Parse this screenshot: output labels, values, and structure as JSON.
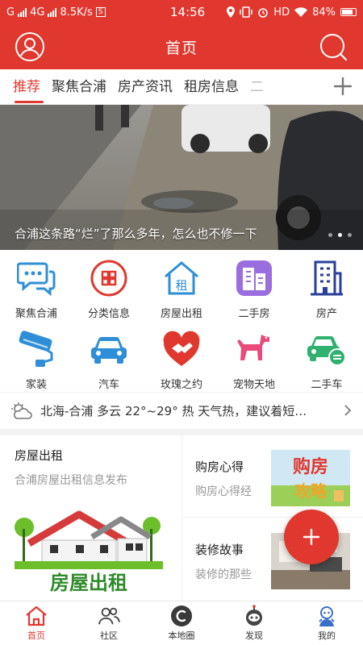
{
  "status_bar": {
    "carrier": "G",
    "network": "4G",
    "speed": "8.5K/s",
    "sim_badge": "S",
    "time": "14:56",
    "hd": "HD",
    "battery": "84%"
  },
  "header": {
    "title": "首页"
  },
  "tabs": [
    {
      "label": "推荐",
      "active": true
    },
    {
      "label": "聚焦合浦",
      "active": false
    },
    {
      "label": "房产资讯",
      "active": false
    },
    {
      "label": "租房信息",
      "active": false
    },
    {
      "label": "二",
      "active": false
    }
  ],
  "banner": {
    "caption": "合浦这条路“烂”了那么多年，怎么也不修一下"
  },
  "grid": [
    {
      "label": "聚焦合浦",
      "icon": "chat-bubbles-icon"
    },
    {
      "label": "分类信息",
      "icon": "category-icon"
    },
    {
      "label": "房屋出租",
      "icon": "house-rent-icon"
    },
    {
      "label": "二手房",
      "icon": "buildings-purple-icon"
    },
    {
      "label": "房产",
      "icon": "building-icon"
    },
    {
      "label": "家装",
      "icon": "paint-roller-icon"
    },
    {
      "label": "汽车",
      "icon": "car-icon"
    },
    {
      "label": "玫瑰之约",
      "icon": "handshake-heart-icon"
    },
    {
      "label": "宠物天地",
      "icon": "dog-icon"
    },
    {
      "label": "二手车",
      "icon": "used-car-icon"
    }
  ],
  "weather": {
    "text": "北海-合浦 多云 22°~29° 热 天气热，建议着短…"
  },
  "cards": {
    "left": {
      "title": "房屋出租",
      "subtitle": "合浦房屋出租信息发布",
      "image_text": "房屋出租"
    },
    "right": [
      {
        "title": "购房心得",
        "subtitle": "购房心得经",
        "image_text_1": "购房",
        "image_text_2": "攻略"
      },
      {
        "title": "装修故事",
        "subtitle": "装修的那些"
      }
    ]
  },
  "tabbar": [
    {
      "label": "首页",
      "active": true
    },
    {
      "label": "社区",
      "active": false
    },
    {
      "label": "本地圈",
      "active": false
    },
    {
      "label": "发现",
      "active": false
    },
    {
      "label": "我的",
      "active": false
    }
  ],
  "colors": {
    "brand_red": "#e0382f",
    "weather_bar_bg": "#ffffff"
  }
}
